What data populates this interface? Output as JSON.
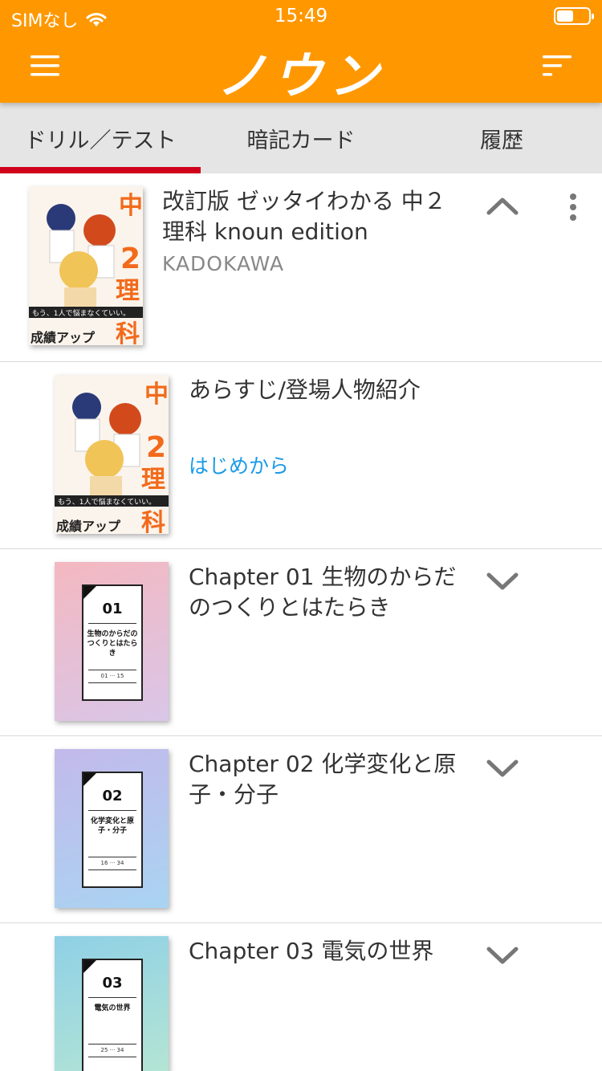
{
  "status": {
    "carrier": "SIMなし",
    "time": "15:49",
    "battery_level": 0.5
  },
  "appbar": {
    "logo": "ノウン"
  },
  "tabs": [
    {
      "label": "ドリル／テスト",
      "active": true
    },
    {
      "label": "暗記カード",
      "active": false
    },
    {
      "label": "履歴",
      "active": false
    }
  ],
  "book": {
    "title": "改訂版 ゼッタイわかる 中２理科 knoun edition",
    "publisher": "KADOKAWA"
  },
  "synopsis": {
    "title": "あらすじ/登場人物紹介",
    "link": "はじめから"
  },
  "chapters": [
    {
      "title": "Chapter 01 生物のからだのつくりとはたらき",
      "cover_num": "01",
      "cover_title": "生物のからだのつくりとはたらき",
      "cover_pages": "01 ··· 15",
      "colors": [
        "#f4b8c0",
        "#d9c6e8"
      ]
    },
    {
      "title": "Chapter 02 化学変化と原子・分子",
      "cover_num": "02",
      "cover_title": "化学変化と原子・分子",
      "cover_pages": "16 ··· 34",
      "colors": [
        "#c3b9ea",
        "#a9d4f2"
      ]
    },
    {
      "title": "Chapter 03 電気の世界",
      "cover_num": "03",
      "cover_title": "電気の世界",
      "cover_pages": "25 ··· 34",
      "colors": [
        "#8fd0e6",
        "#b9e8d2"
      ]
    }
  ],
  "colors": {
    "accent": "#ff9800",
    "tab_indicator": "#d0021b",
    "link": "#1a9be8"
  }
}
